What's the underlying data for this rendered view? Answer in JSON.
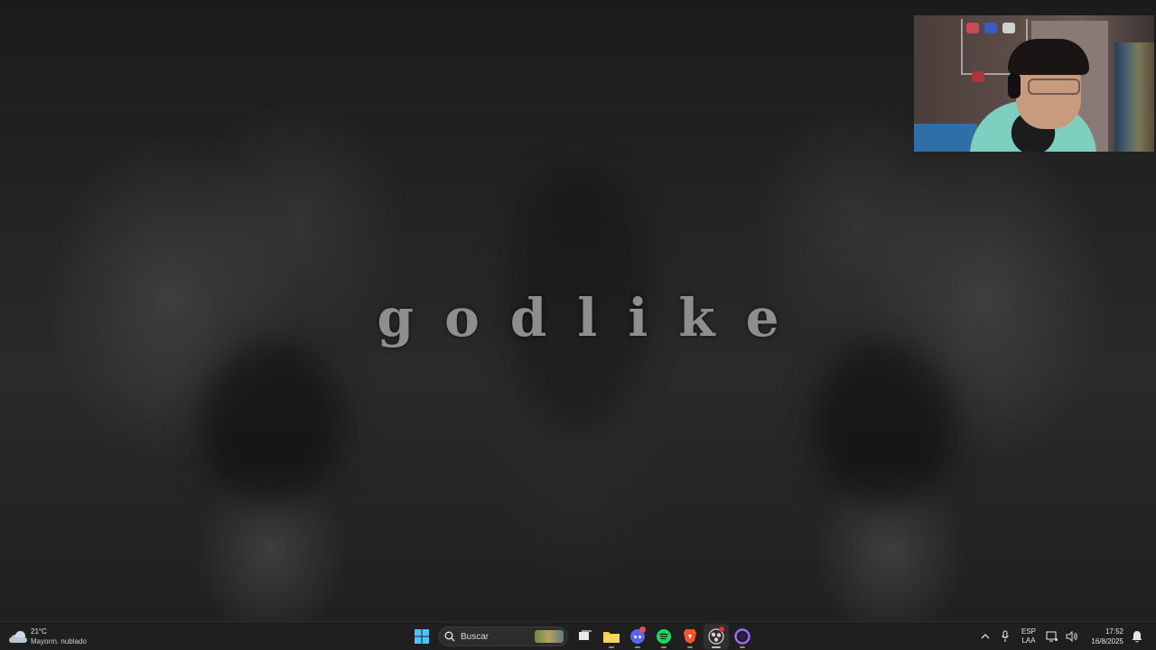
{
  "wallpaper": {
    "title": "godlike"
  },
  "weather": {
    "temperature": "21°C",
    "condition": "Mayorm. nublado",
    "icon": "cloud-icon"
  },
  "taskbar": {
    "search": {
      "placeholder": "Buscar"
    },
    "apps": [
      {
        "name": "start-button",
        "icon": "windows-logo-icon"
      },
      {
        "name": "task-view",
        "icon": "task-view-icon"
      },
      {
        "name": "file-explorer",
        "icon": "folder-icon"
      },
      {
        "name": "discord",
        "icon": "discord-icon",
        "badge": true
      },
      {
        "name": "spotify",
        "icon": "spotify-icon"
      },
      {
        "name": "brave",
        "icon": "brave-lion-icon"
      },
      {
        "name": "obs",
        "icon": "obs-icon",
        "active": true
      },
      {
        "name": "app-circle",
        "icon": "purple-circle-icon"
      }
    ]
  },
  "tray": {
    "language_top": "ESP",
    "language_bottom": "LAA",
    "time": "17:52",
    "date": "16/8/2025"
  },
  "colors": {
    "taskbar_bg": "#1f1f1f",
    "wallpaper_text": "#8e8e8e",
    "spotify": "#1ed760",
    "discord": "#5865f2",
    "brave": "#fb542b",
    "folder": "#f2c94c"
  }
}
